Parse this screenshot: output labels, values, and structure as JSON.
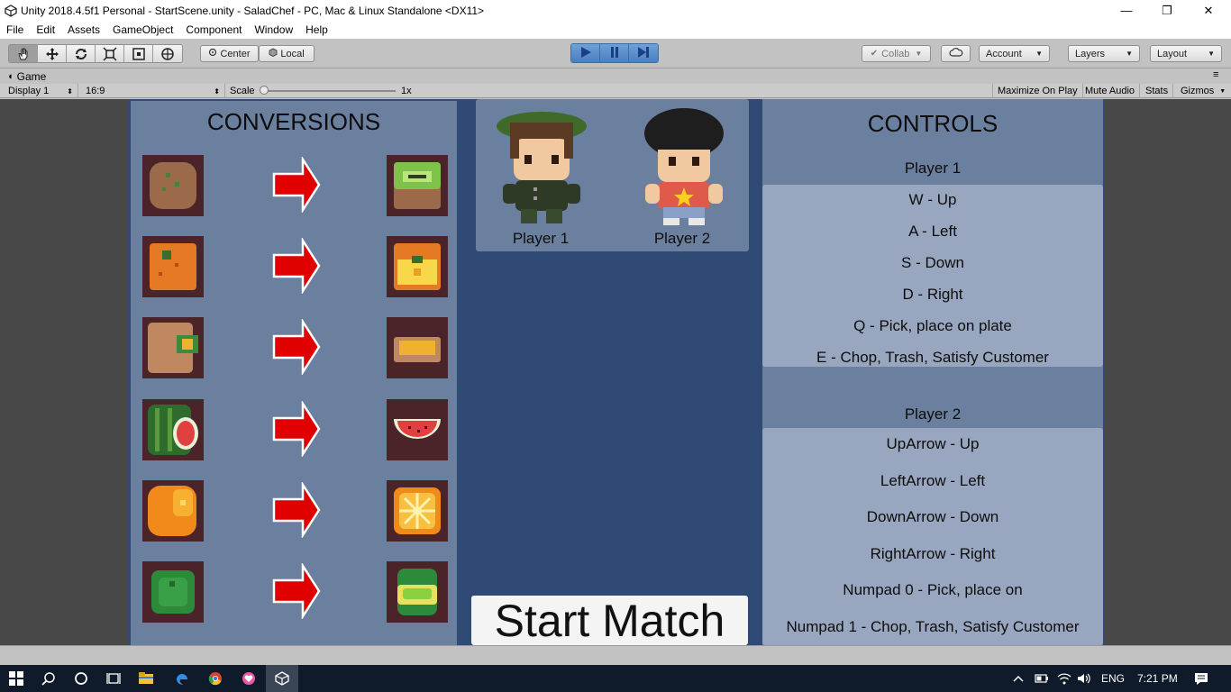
{
  "window": {
    "title": "Unity 2018.4.5f1 Personal - StartScene.unity - SaladChef - PC, Mac & Linux Standalone <DX11>",
    "minimize": "—",
    "maximize": "❐",
    "close": "✕"
  },
  "menubar": [
    "File",
    "Edit",
    "Assets",
    "GameObject",
    "Component",
    "Window",
    "Help"
  ],
  "toolbar": {
    "pivot_label": "Center",
    "space_label": "Local",
    "collab_label": "Collab",
    "account_label": "Account",
    "layers_label": "Layers",
    "layout_label": "Layout"
  },
  "game_tab": {
    "label": "Game",
    "display": "Display 1",
    "aspect": "16:9",
    "scale_label": "Scale",
    "scale_value": "1x",
    "maximize_on_play": "Maximize On Play",
    "mute_audio": "Mute Audio",
    "stats": "Stats",
    "gizmos": "Gizmos"
  },
  "game": {
    "conversions_title": "CONVERSIONS",
    "players": [
      "Player 1",
      "Player 2"
    ],
    "start_button": "Start Match",
    "controls_title": "CONTROLS",
    "player1_header": "Player 1",
    "player1_controls": [
      "W - Up",
      "A - Left",
      "S  - Down",
      "D - Right",
      "Q - Pick, place on plate",
      "E - Chop, Trash, Satisfy Customer"
    ],
    "player2_header": "Player 2",
    "player2_controls": [
      "UpArrow - Up",
      "LeftArrow - Left",
      "DownArrow  - Down",
      "RightArrow - Right",
      "Numpad 0 - Pick, place on",
      "Numpad 1 - Chop, Trash, Satisfy Customer"
    ]
  },
  "taskbar": {
    "language": "ENG",
    "time": "7:21 PM"
  }
}
